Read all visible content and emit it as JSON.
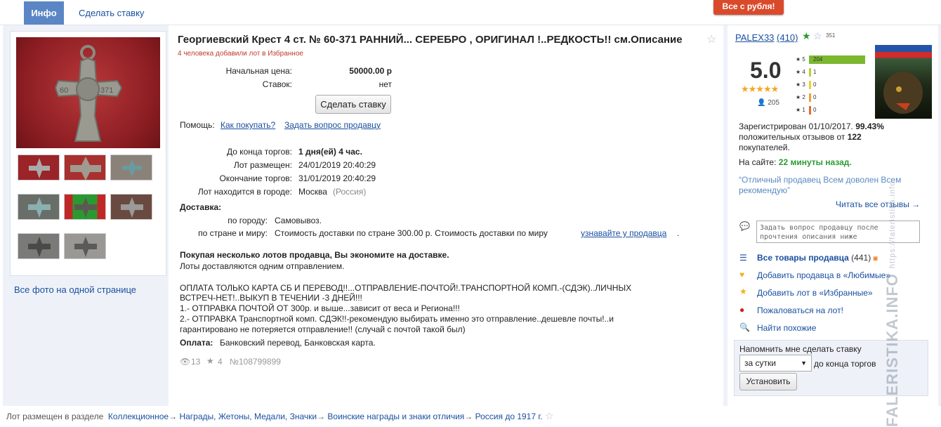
{
  "tabs": {
    "info": "Инфо",
    "bid": "Сделать ставку"
  },
  "promo": "Все с рубля!",
  "lot": {
    "title": "Георгиевский Крест 4 ст. № 60-371 РАННИЙ... СЕРЕБРО , ОРИГИНАЛ !..РЕДКОСТЬ!! см.Описание",
    "favorites": "4 человека добавили лот в Избранное",
    "start_price_label": "Начальная цена:",
    "start_price": "50000.00 р",
    "bids_label": "Ставок:",
    "bids": "нет",
    "bid_button": "Сделать ставку",
    "help_label": "Помощь:",
    "help_how": "Как покупать?",
    "help_ask": "Задать вопрос продавцу",
    "ends_label": "До конца торгов:",
    "ends": "1 дня(ей) 4 час.",
    "placed_label": "Лот размещен:",
    "placed": "24/01/2019 20:40:29",
    "end_label": "Окончание торгов:",
    "end": "31/01/2019 20:40:29",
    "city_label": "Лот находится в городе:",
    "city": "Москва",
    "country": "(Россия)",
    "delivery_label": "Доставка:",
    "city_del_label": "по городу:",
    "city_del": "Самовывоз.",
    "world_del_label": "по стране и миру:",
    "world_del": "Стоимость доставки по стране 300.00 р. Стоимость доставки по миру",
    "world_del_link": "узнавайте у продавца",
    "save_bold": "Покупая несколько лотов продавца, Вы экономите на доставке.",
    "save_text": "Лоты доставляются одним отправлением.",
    "desc1": "ОПЛАТА ТОЛЬКО КАРТА СБ И ПЕРЕВОД!!...ОТПРАВЛЕНИЕ-ПОЧТОЙ!.ТРАНСПОРТНОЙ КОМП.-(СДЭК)..ЛИЧНЫХ",
    "desc2": "ВСТРЕЧ-НЕТ!..ВЫКУП В ТЕЧЕНИИ -3 ДНЕЙ!!!",
    "desc3": "1.- ОТПРАВКА ПОЧТОЙ ОТ 300р. и выше...зависит от веса и Региона!!!",
    "desc4": "2.- ОТПРАВКА Транспортной комп. СДЭК!!-рекомендую выбирать именно это отправление..дешевле почты!..и",
    "desc5": "гарантировано не потеряется отправление!! (случай с почтой такой был)",
    "pay_label": "Оплата:",
    "pay": "Банковский перевод, Банковская карта.",
    "views": "13",
    "stars": "4",
    "number": "№108799899"
  },
  "photos": {
    "all": "Все фото на одной странице",
    "medal_text_left": "60",
    "medal_text_right": "371"
  },
  "seller": {
    "name": "PALEX33",
    "count": "(410)",
    "small_count": "351",
    "rating": "5.0",
    "reviews_count": "205",
    "breakdown": [
      {
        "star": "5",
        "n": "204",
        "frac": 1.0,
        "color": "#7cb82f"
      },
      {
        "star": "4",
        "n": "1",
        "frac": 0.02,
        "color": "#b5d334"
      },
      {
        "star": "3",
        "n": "0",
        "frac": 0,
        "color": "#e8d234"
      },
      {
        "star": "2",
        "n": "0",
        "frac": 0,
        "color": "#f0a030"
      },
      {
        "star": "1",
        "n": "0",
        "frac": 0,
        "color": "#e86a30"
      }
    ],
    "reg": "Зарегистрирован 01/10/2017.",
    "pct": "99.43%",
    "pos_text": "положительных отзывов от",
    "pos_n": "122",
    "buyers": "покупателей.",
    "online_label": "На сайте:",
    "online": "22 минуты назад.",
    "quote1": "“Отличный продавец Всем доволен Всем",
    "quote2": "рекомендую”",
    "all_reviews": "Читать все отзывы →",
    "ask_placeholder": "Задать вопрос продавцу после прочтения описания ниже",
    "all_goods": "Все товары продавца",
    "goods_count": "(441)",
    "add_fav": "Добавить продавца в «Любимые»",
    "add_lot": "Добавить лот в «Избранные»",
    "complain": "Пожаловаться на лот!",
    "similar": "Найти похожие",
    "remind_label": "Напомнить мне сделать ставку",
    "remind_option": "за сутки",
    "remind_suffix": "до конца торгов",
    "remind_btn": "Установить"
  },
  "footer": {
    "label": "Лот размещен в разделе",
    "c1": "Коллекционное",
    "c2": "Награды, Жетоны, Медали, Значки",
    "c3": "Воинские награды и знаки отличия",
    "c4": "Россия до 1917 г."
  },
  "watermark": "FALERISTIKA.INFO",
  "watermark_small": "https://faleristika.info"
}
